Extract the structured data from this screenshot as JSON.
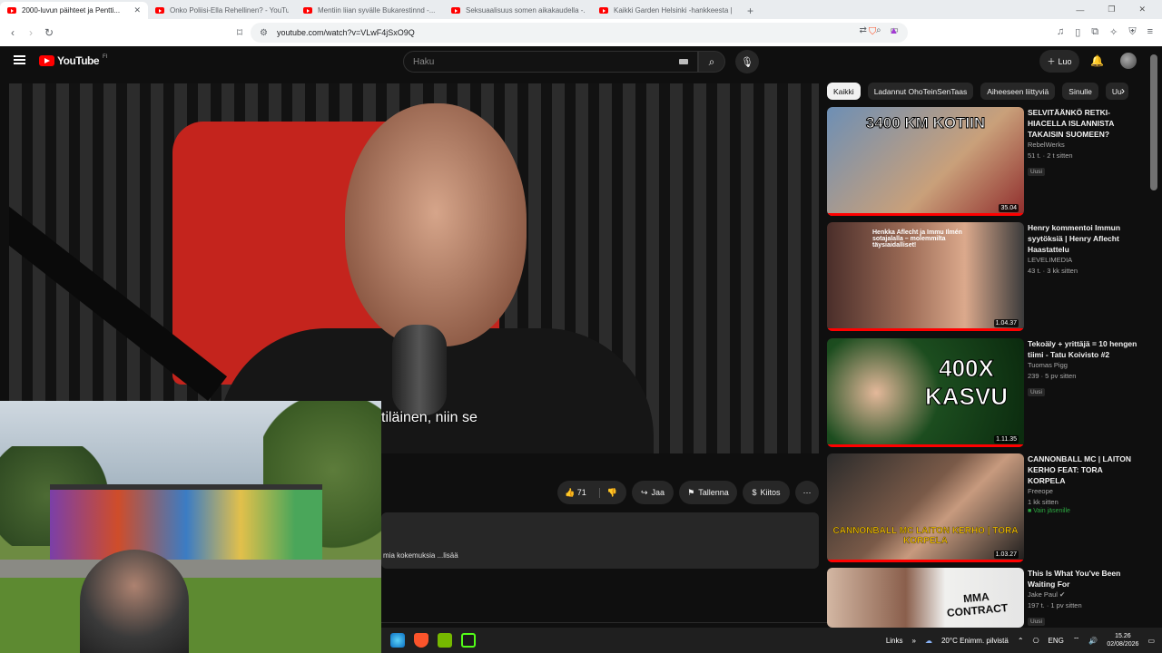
{
  "browser": {
    "tabs": [
      {
        "label": "2000-luvun päihteet ja Pentti...",
        "active": true
      },
      {
        "label": "Onko Poliisi-Ella Rehellinen? - YouTu...",
        "active": false
      },
      {
        "label": "Mentiin liian syvälle Bukarestinnd -...",
        "active": false
      },
      {
        "label": "Seksuaalisuus somen aikakaudella -...",
        "active": false
      },
      {
        "label": "Kaikki Garden Helsinki -hankkeesta |...",
        "active": false
      }
    ],
    "new_tab": "+",
    "url": "youtube.com/watch?v=VLwF4jSxO9Q"
  },
  "youtube": {
    "logo_text": "YouTube",
    "logo_region": "FI",
    "search_placeholder": "Haku",
    "create_label": "Luo"
  },
  "video": {
    "subtitle": "tiläinen, niin se",
    "actions": {
      "like_count": "71",
      "share": "Jaa",
      "save": "Tallenna",
      "thanks": "Kiitos"
    },
    "description_snippet": "mia kokemuksia  ...lisää"
  },
  "chips": [
    "Kaikki",
    "Ladannut OhoTeinSenTaas",
    "Aiheeseen liittyviä",
    "Sinulle",
    "Uu"
  ],
  "recommendations": [
    {
      "title": "SELVITÄÄNKÖ RETKI-HIACELLA ISLANNISTA TAKAISIN SUOMEEN?",
      "channel": "RebelWerks",
      "meta": "51 t. · 2 t sitten",
      "badge": "Uusi",
      "duration": "35.04",
      "thumb_text": "3400 KM KOTIIN",
      "progress": 1.0
    },
    {
      "title": "Henry kommentoi Immun syytöksiä | Henry Aflecht Haastattelu",
      "channel": "LEVELIMEDIA",
      "meta": "43 t. · 3 kk sitten",
      "badge": "",
      "duration": "1.04.37",
      "thumb_text": "Henkka Aflecht ja Immu Ilmén sotajalalla – molemmilta täysiaidalliset!",
      "progress": 1.0
    },
    {
      "title": "Tekoäly + yrittäjä = 10 hengen tiimi - Tatu Koivisto #2",
      "channel": "Tuomas Pigg",
      "meta": "239 · 5 pv sitten",
      "badge": "Uusi",
      "duration": "1.11.35",
      "thumb_text": "400X KASVU",
      "progress": 1.0
    },
    {
      "title": "CANNONBALL MC | LAITON KERHO FEAT: TORA KORPELA",
      "channel": "Freeope",
      "meta": "1 kk sitten",
      "badge": "Vain jäsenille",
      "duration": "1.03.27",
      "thumb_text": "CANNONBALL MC LAITON KERHO | TORA KORPELA",
      "progress": 1.0
    },
    {
      "title": "This Is What You've Been Waiting For",
      "channel": "Jake Paul",
      "meta": "197 t. · 1 pv sitten",
      "badge": "Uusi",
      "duration": "",
      "thumb_text": "MMA CONTRACT",
      "progress": 0
    }
  ],
  "taskbar": {
    "links": "Links",
    "weather": "20°C  Enimm. pilvistä",
    "lang": "ENG",
    "time": "15.26",
    "date": "02/08/2026"
  },
  "colors": {
    "accent": "#ff0000",
    "bg": "#0f0f0f",
    "surface": "#272727"
  }
}
